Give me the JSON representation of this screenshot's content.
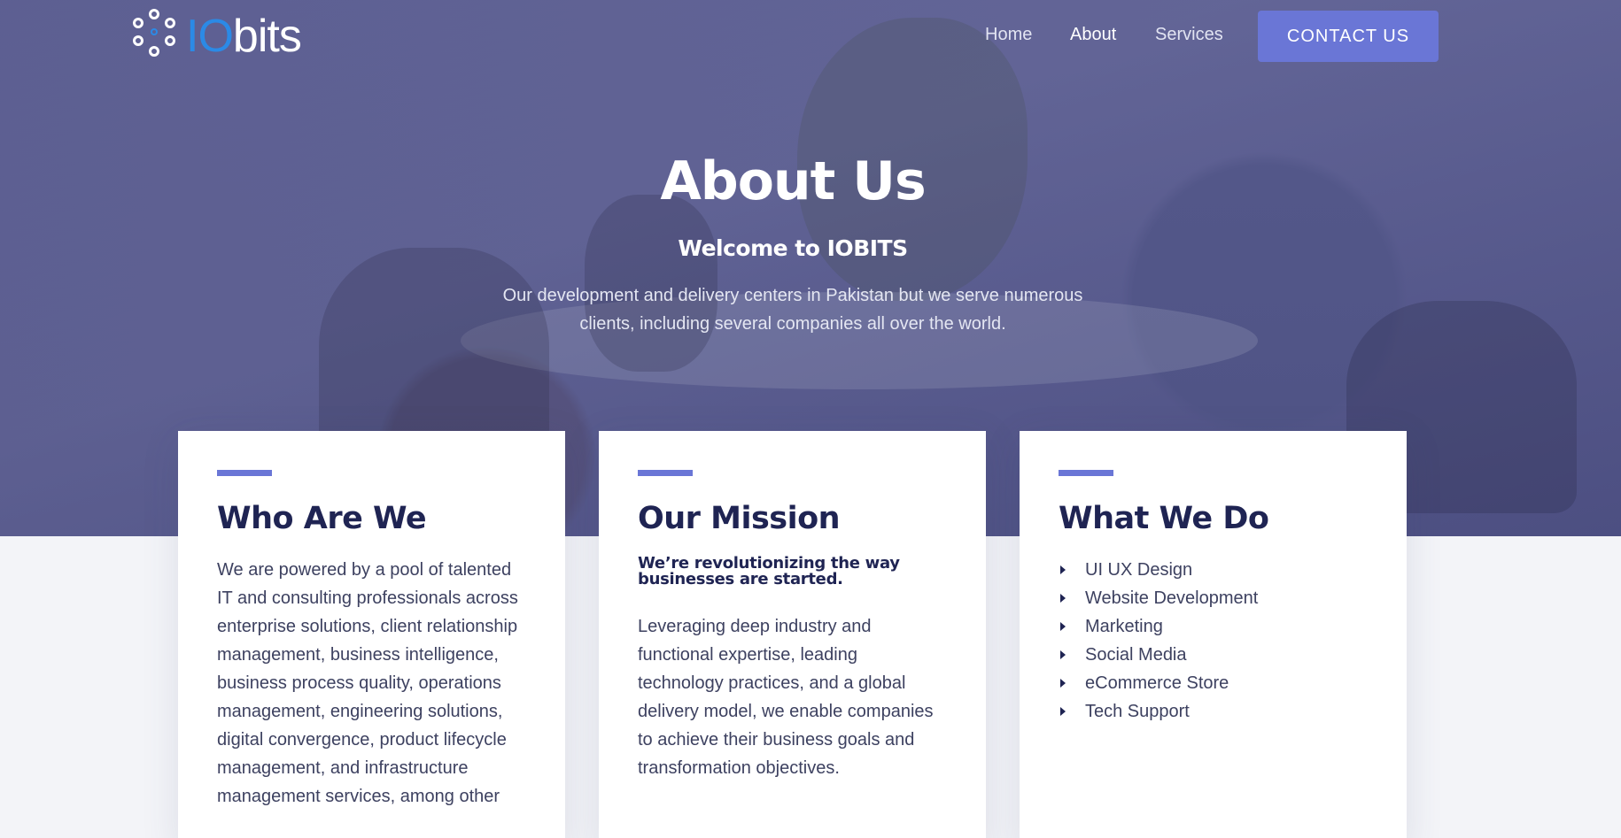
{
  "brand": {
    "logo_io": "IO",
    "logo_bits": "bits"
  },
  "nav": {
    "home": "Home",
    "about": "About",
    "services": "Services",
    "contact": "CONTACT US"
  },
  "hero": {
    "title": "About Us",
    "subtitle": "Welcome to IOBITS",
    "description": "Our development and delivery centers in Pakistan but we serve numerous clients, including several companies all over the world."
  },
  "cards": [
    {
      "title": "Who Are We",
      "text": "We are powered by a pool of talented IT and consulting professionals across enterprise solutions, client relationship management, business intelligence, business process quality, operations management, engineering solutions, digital convergence, product lifecycle management, and infrastructure management services, among other"
    },
    {
      "title": "Our Mission",
      "tagline_1": "We’re revolutionizing the way",
      "tagline_2": "businesses are started.",
      "text": "Leveraging deep industry and functional expertise, leading technology practices, and a global delivery model, we enable companies to achieve their business goals and transformation objectives."
    },
    {
      "title": "What We Do",
      "items": [
        "UI UX Design",
        "Website Development",
        "Marketing",
        "Social Media",
        "eCommerce Store",
        "Tech Support"
      ]
    }
  ],
  "colors": {
    "accent": "#6a76d6",
    "heading": "#1f2453",
    "logo_io": "#2b8ae6",
    "page_bg": "#f3f4f8"
  },
  "icons": {
    "logo_mark": "dots-ring-icon",
    "list_bullet": "caret-right-icon"
  }
}
